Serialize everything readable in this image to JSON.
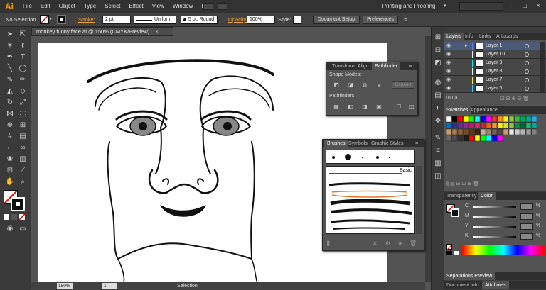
{
  "app": {
    "logo": "Ai",
    "workspace": "Printing and Proofing"
  },
  "menu": [
    "File",
    "Edit",
    "Object",
    "Type",
    "Select",
    "Effect",
    "View",
    "Window",
    "Help"
  ],
  "control_bar": {
    "selection_label": "No Selection",
    "stroke_label": "Stroke:",
    "stroke_weight": "2 pt",
    "profile": "Uniform",
    "brush": "5 pt. Round",
    "opacity_label": "Opacity:",
    "opacity_value": "100%",
    "style_label": "Style:",
    "doc_setup": "Document Setup",
    "preferences": "Preferences"
  },
  "document": {
    "tab_title": "monkey funny face.ai @ 150% (CMYK/Preview)",
    "close": "×"
  },
  "status": {
    "zoom": "150%",
    "page": "1",
    "tool": "Selection"
  },
  "pathfinder_panel": {
    "tabs": [
      "Transform",
      "Align",
      "Pathfinder"
    ],
    "shape_modes_label": "Shape Modes:",
    "expand": "Expand",
    "pathfinders_label": "Pathfinders:"
  },
  "brushes_panel": {
    "tabs": [
      "Brushes",
      "Symbols",
      "Graphic Styles"
    ],
    "basic_label": "Basic"
  },
  "layers_panel": {
    "tabs": [
      "Layers",
      "Info",
      "Links",
      "Artboards"
    ],
    "layers": [
      {
        "name": "Layer 1",
        "color": "#4f7fff",
        "selected": true
      },
      {
        "name": "Layer 10",
        "color": "#e8e8e8"
      },
      {
        "name": "Layer 9",
        "color": "#2ee0e0"
      },
      {
        "name": "Layer 8",
        "color": "#e8e8e8"
      },
      {
        "name": "Layer 7",
        "color": "#f2e84a"
      },
      {
        "name": "Layer 6",
        "color": "#3ac0ff"
      }
    ],
    "footer": "10 La..."
  },
  "swatches_panel": {
    "tabs": [
      "Swatches",
      "Appearance"
    ]
  },
  "color_panel": {
    "tabs": [
      "Transparency",
      "Color"
    ],
    "channels": [
      "C",
      "M",
      "Y",
      "K"
    ],
    "unit": "%"
  },
  "bottom_panels": {
    "separations": "Separations Preview",
    "document_info": "Document Info",
    "attributes": "Attributes"
  }
}
